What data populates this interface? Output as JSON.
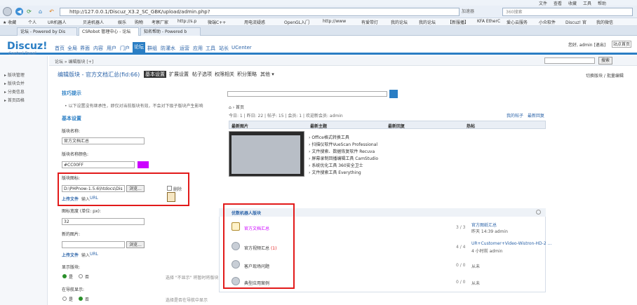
{
  "browser": {
    "menu": [
      "文件",
      "查看",
      "收藏",
      "工具",
      "帮助"
    ],
    "url": "http://127.0.0.1/Discuz_X3.2_SC_GBK/upload/admin.php?",
    "addr_extra": "加速器",
    "search_placeholder": "360搜索",
    "bookmarks": [
      "收藏",
      "个人",
      "UR机器人",
      "贝迪机器人",
      "娱乐",
      "购物",
      "考察厂家",
      "http://s.p",
      "微端C++",
      "用电流疑惑",
      "OpenGL入门",
      "http://www",
      "有爱带灯",
      "我的论坛",
      "我的论坛",
      "【新服播】",
      "KFA EtherC",
      "爱心云服务",
      "小众软件",
      "Discuz! 官",
      "我的微信"
    ],
    "tabs": [
      "论坛 - Powered by Dis",
      "CSRobot 管理中心 - 论坛",
      "知名帮助 - Powered b"
    ]
  },
  "brand": {
    "name": "Discuz!",
    "sub": "Control Panel"
  },
  "main_nav": [
    "首页",
    "全局",
    "界面",
    "内容",
    "用户",
    "门户",
    "论坛",
    "群组",
    "防灌水",
    "运营",
    "应用",
    "工具",
    "站长",
    "UCenter"
  ],
  "main_nav_current": "论坛",
  "user": {
    "text": "您好, admin [退出]",
    "site_home": "站点首页"
  },
  "sidebar": [
    "版块管理",
    "版块合并",
    "分类信息",
    "首页四格"
  ],
  "crumb": "论坛 » 编辑版块 [+]",
  "search_button": "搜索",
  "edit": {
    "title": "编辑版块 - 官方文档汇总(fid:66)",
    "tabs": [
      "基本设置",
      "扩展设置",
      "帖子选项",
      "权限相关",
      "积分策略",
      "其他"
    ],
    "switch_link": "切换版块 / 批量编辑"
  },
  "tips": {
    "head": "技巧提示",
    "line": "以下设置没有继承性，即仅对当前版块有效，不会对下级子版块产生影响"
  },
  "settings": {
    "head": "基本设置",
    "name_label": "版块名称:",
    "name_value": "官方文档汇总",
    "color_label": "版块名称颜色:",
    "color_value": "#CC00FF",
    "color_swatch": "#cc00ff",
    "icon_label": "版块图标:",
    "icon_path": "D:\\PHPnow-1.5.6\\htdocs\\Dis",
    "browse": "浏览...",
    "delete_label": "删除",
    "upload_link": "上传文件",
    "input_link": "输入",
    "url_link": "URL",
    "width_label": "图标宽度 (单位: px):",
    "width_value": "32",
    "new_icon_label": "新的图片:",
    "show_label": "显示版块:",
    "yes": "是",
    "no": "否",
    "show_tip": "选择 \"不显示\" 将暂时将版块",
    "nav_label": "在导航显示:",
    "nav_tip": "选择是否在导航中显示"
  },
  "preview": {
    "home": "首页",
    "stats": "今日: 1 | 昨日: 22 | 帖子: 15 | 会员: 1 | 欢迎新会员: admin",
    "right_links": [
      "我的帖子",
      "最新回复"
    ],
    "cols": [
      "最新图片",
      "最新主题",
      "最新回复",
      "热帖"
    ],
    "threads": [
      "Office格式转换工具",
      "扫描仪软件VueScan Professional",
      "文件搜索、数据恢复软件 Recuva",
      "屏幕录制回播编辑工具 CamStudio",
      "系统优化工具 360安全卫士",
      "文件搜索工具 Everything"
    ]
  },
  "forum_list": {
    "header": "优数机器人版块",
    "items": [
      {
        "name": "官方文档汇总",
        "count": "3 / 3",
        "last": "官方图纸汇总",
        "last2": "昨天 14:39 admin",
        "highlight": true
      },
      {
        "name": "官方视频汇总",
        "extra": "(1)",
        "count": "4 / 4",
        "last": "UR+Customer+Video-Wistron-HD-2 ...",
        "last2": "4 小时前 admin"
      },
      {
        "name": "客户现场问题",
        "count": "0 / 0",
        "last": "从未"
      },
      {
        "name": "典型应用案例",
        "count": "0 / 0",
        "last": "从未"
      }
    ]
  }
}
